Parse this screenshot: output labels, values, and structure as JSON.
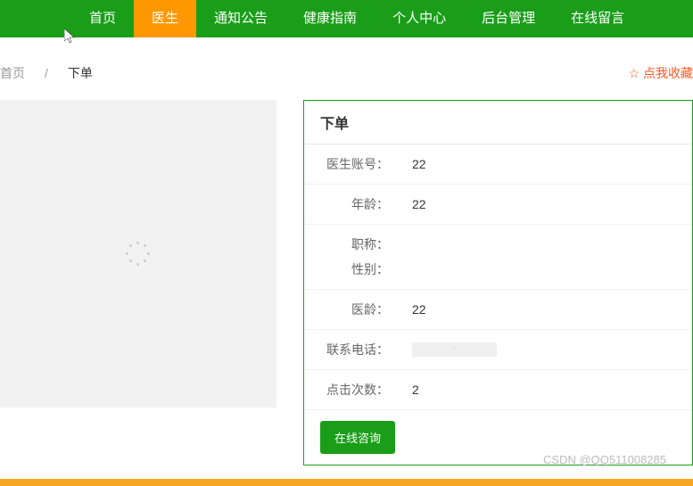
{
  "nav": {
    "items": [
      {
        "label": "首页"
      },
      {
        "label": "医生"
      },
      {
        "label": "通知公告"
      },
      {
        "label": "健康指南"
      },
      {
        "label": "个人中心"
      },
      {
        "label": "后台管理"
      },
      {
        "label": "在线留言"
      }
    ],
    "active_index": 1
  },
  "breadcrumb": {
    "home": "首页",
    "sep": "/",
    "current": "下单"
  },
  "favorite": {
    "star": "☆",
    "label": "点我收藏"
  },
  "panel": {
    "title": "下单",
    "fields": {
      "doctor_account": {
        "label": "医生账号：",
        "value": "22"
      },
      "age": {
        "label": "年龄：",
        "value": "22"
      },
      "title_rank": {
        "label": "职称：",
        "value": ""
      },
      "gender": {
        "label": "性别：",
        "value": ""
      },
      "years": {
        "label": "医龄：",
        "value": "22"
      },
      "phone": {
        "label": "联系电话：",
        "value": "·"
      },
      "clicks": {
        "label": "点击次数：",
        "value": "2"
      }
    },
    "action_button": "在线咨询"
  },
  "watermark": "CSDN @QQ511008285"
}
